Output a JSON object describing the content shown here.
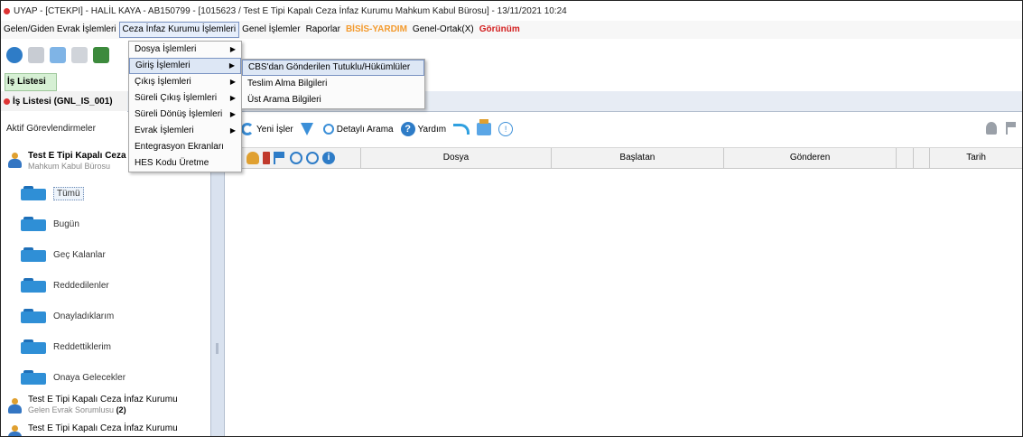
{
  "window": {
    "title": "UYAP - [CTEKPI] -  HALİL KAYA - AB150799 - [1015623 / Test E Tipi Kapalı Ceza İnfaz Kurumu Mahkum Kabul Bürosu] - 13/11/2021 10:24"
  },
  "menubar": {
    "items": [
      {
        "label": "Gelen/Giden Evrak İşlemleri"
      },
      {
        "label": "Ceza İnfaz Kurumu İşlemleri"
      },
      {
        "label": "Genel İşlemler"
      },
      {
        "label": "Raporlar"
      },
      {
        "label": "BİSİS-YARDIM"
      },
      {
        "label": "Genel-Ortak(X)"
      },
      {
        "label": "Görünüm"
      }
    ]
  },
  "left": {
    "header": "İş Listesi",
    "list_title": "İş Listesi (GNL_IS_001)",
    "aktif": "Aktif Görevlendirmeler",
    "root_title": "Test E Tipi Kapalı Ceza İ",
    "root_sub": "Mahkum Kabul Bürosu",
    "folders": [
      {
        "label": "Tümü"
      },
      {
        "label": "Bugün"
      },
      {
        "label": "Geç Kalanlar"
      },
      {
        "label": "Reddedilenler"
      },
      {
        "label": "Onayladıklarım"
      },
      {
        "label": "Reddettiklerim"
      },
      {
        "label": "Onaya Gelecekler"
      }
    ],
    "child1_title": "Test E Tipi Kapalı Ceza İnfaz Kurumu",
    "child1_sub": "Gelen Evrak Sorumlusu",
    "child1_count": "(2)",
    "child2_title": "Test E Tipi Kapalı Ceza İnfaz Kurumu"
  },
  "toolbar": {
    "yeni_isler": "Yeni İşler",
    "detayli_arama": "Detaylı Arama",
    "yardim": "Yardım"
  },
  "grid": {
    "columns": [
      "Dosya",
      "Başlatan",
      "Gönderen",
      "Tarih"
    ]
  },
  "menu1": {
    "items": [
      {
        "label": "Dosya İşlemleri"
      },
      {
        "label": "Giriş İşlemleri"
      },
      {
        "label": "Çıkış İşlemleri"
      },
      {
        "label": "Süreli Çıkış İşlemleri"
      },
      {
        "label": "Süreli Dönüş İşlemleri"
      },
      {
        "label": "Evrak İşlemleri"
      },
      {
        "label": "Entegrasyon Ekranları"
      },
      {
        "label": "HES Kodu Üretme"
      }
    ]
  },
  "menu2": {
    "items": [
      {
        "label": "CBS'dan Gönderilen Tutuklu/Hükümlüler"
      },
      {
        "label": "Teslim Alma Bilgileri"
      },
      {
        "label": "Üst Arama Bilgileri"
      }
    ]
  },
  "colors": {
    "orange": "#f39a2d",
    "red": "#d32020",
    "accent": "#2e7cc7",
    "highlight": "#dde7f5"
  }
}
